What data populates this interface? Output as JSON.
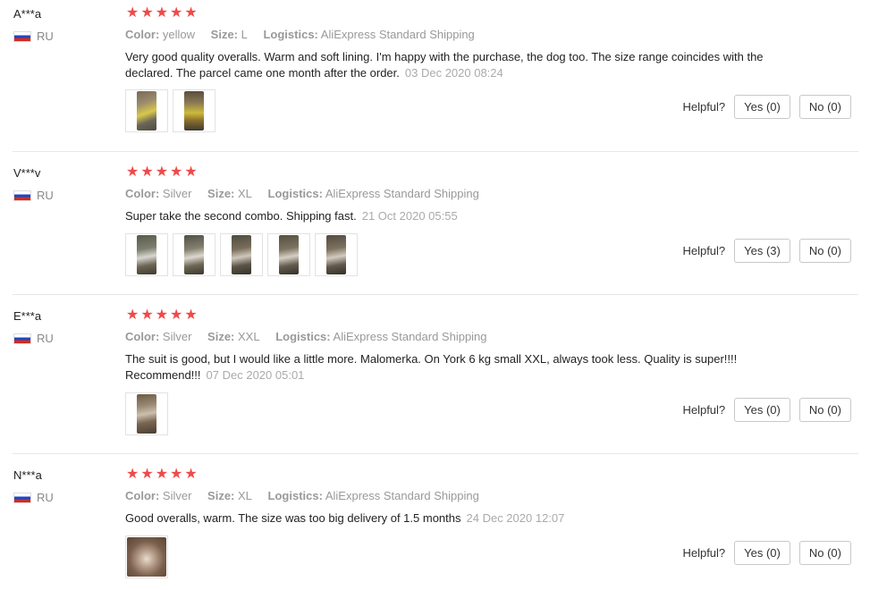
{
  "labels": {
    "color": "Color:",
    "size": "Size:",
    "logistics": "Logistics:",
    "helpful": "Helpful?"
  },
  "colors": {
    "star": "#ef4a4a"
  },
  "reviews": [
    {
      "user": "A***a",
      "country": "RU",
      "rating": 5,
      "color": "yellow",
      "size": "L",
      "logistics": "AliExpress Standard Shipping",
      "text": "Very good quality overalls. Warm and soft lining. I'm happy with the purchase, the dog too. The size range coincides with the declared. The parcel came one month after the order.",
      "date": "03 Dec 2020 08:24",
      "photos": 2,
      "yes": "Yes (0)",
      "no": "No (0)"
    },
    {
      "user": "V***v",
      "country": "RU",
      "rating": 5,
      "color": "Silver",
      "size": "XL",
      "logistics": "AliExpress Standard Shipping",
      "text": "Super take the second combo. Shipping fast.",
      "date": "21 Oct 2020 05:55",
      "photos": 5,
      "yes": "Yes (3)",
      "no": "No (0)"
    },
    {
      "user": "E***a",
      "country": "RU",
      "rating": 5,
      "color": "Silver",
      "size": "XXL",
      "logistics": "AliExpress Standard Shipping",
      "text": "The suit is good, but I would like a little more. Malomerka. On York 6 kg small XXL, always took less. Quality is super!!!! Recommend!!!",
      "date": "07 Dec 2020 05:01",
      "photos": 1,
      "yes": "Yes (0)",
      "no": "No (0)"
    },
    {
      "user": "N***a",
      "country": "RU",
      "rating": 5,
      "color": "Silver",
      "size": "XL",
      "logistics": "AliExpress Standard Shipping",
      "text": "Good overalls, warm. The size was too big delivery of 1.5 months",
      "date": "24 Dec 2020 12:07",
      "photos": 1,
      "yes": "Yes (0)",
      "no": "No (0)"
    }
  ]
}
